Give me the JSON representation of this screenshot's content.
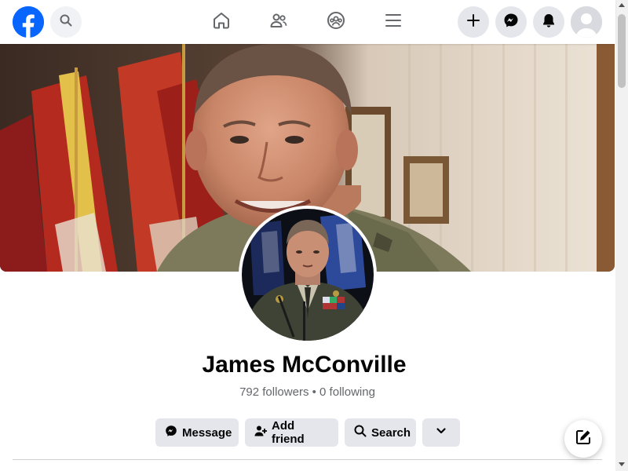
{
  "topbar": {
    "logo_icon": "facebook-logo",
    "search_icon": "search-icon",
    "nav_icons": [
      "home-icon",
      "friends-icon",
      "groups-icon",
      "menu-icon"
    ],
    "action_icons": [
      "plus-icon",
      "messenger-icon",
      "bell-icon"
    ],
    "avatar_icon": "user-avatar"
  },
  "profile": {
    "name": "James McConville",
    "followers": "792 followers",
    "separator": " • ",
    "following": "0 following"
  },
  "actions": {
    "message_label": "Message",
    "add_friend_label": "Add friend",
    "search_label": "Search",
    "more_icon": "chevron-down-icon"
  },
  "compose_icon": "edit-icon",
  "colors": {
    "brand": "#0866ff",
    "button_bg": "#e4e6eb",
    "text_primary": "#050505",
    "text_secondary": "#65676b"
  }
}
